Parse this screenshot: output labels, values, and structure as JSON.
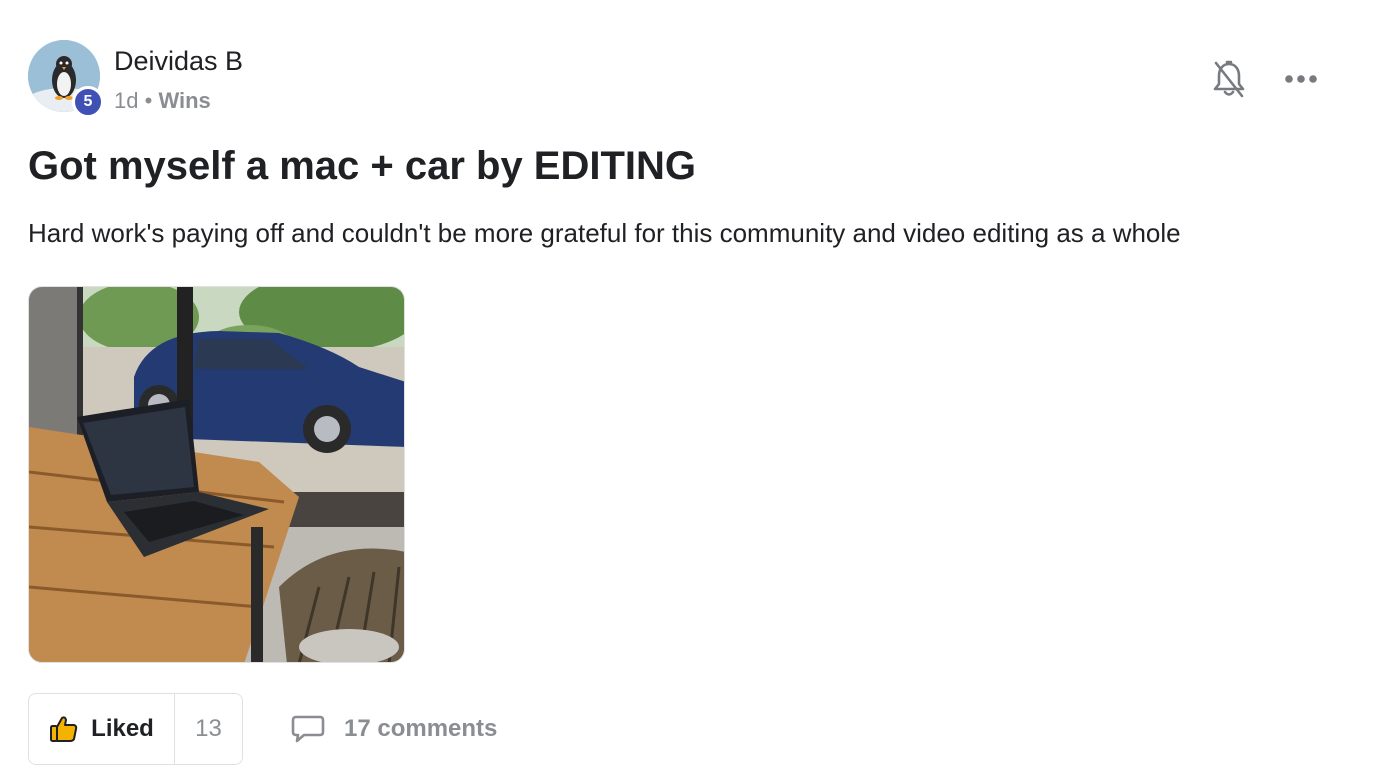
{
  "post": {
    "author": {
      "name": "Deividas B",
      "level": "5",
      "avatar": "penguin-avatar-photo"
    },
    "time_ago": "1d",
    "separator": "•",
    "category": "Wins",
    "title": "Got myself a mac + car by EDITING",
    "body": "Hard work's paying off and couldn't be more grateful for this community and video editing as a whole",
    "image": "laptop-on-table-with-car-photo"
  },
  "actions": {
    "notify_icon": "bell-off-icon",
    "more_icon": "ellipsis-icon",
    "like_label": "Liked",
    "like_icon": "thumbs-up-icon",
    "like_count": "13",
    "comments_icon": "comment-bubble-icon",
    "comments_label": "17 comments"
  },
  "colors": {
    "level_badge": "#3f51b5",
    "like_icon": "#f5b301",
    "muted_text": "#8a8d91",
    "primary_text": "#202124"
  }
}
